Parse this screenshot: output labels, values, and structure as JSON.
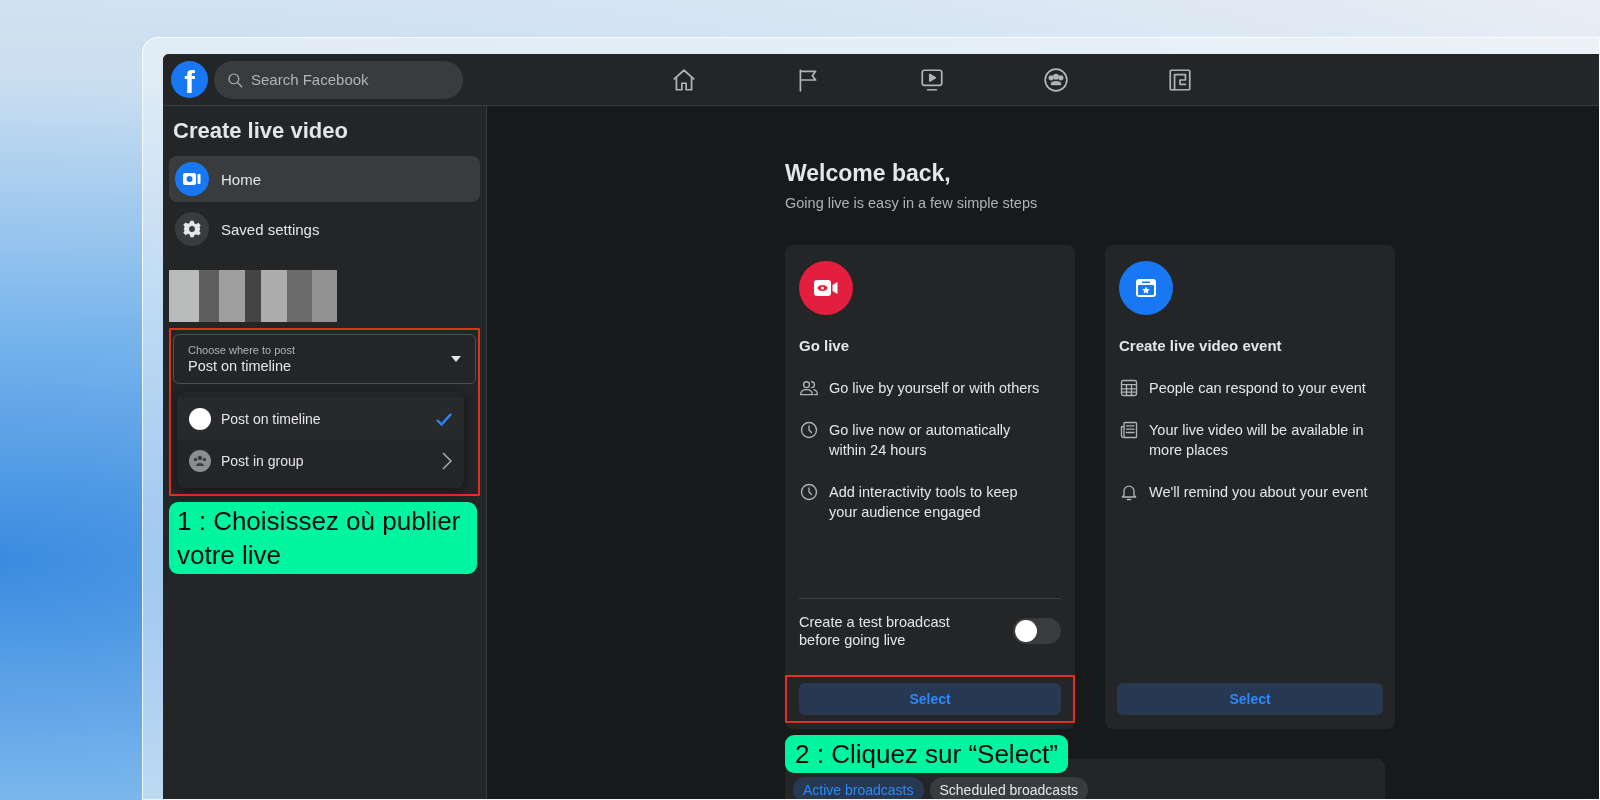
{
  "topbar": {
    "logo": "f",
    "search": {
      "placeholder": "Search Facebook"
    }
  },
  "sidebar": {
    "title": "Create live video",
    "items": [
      {
        "label": "Home",
        "selected": true
      },
      {
        "label": "Saved settings",
        "selected": false
      }
    ],
    "post_target": {
      "highlighted": true,
      "label": "Choose where to post",
      "value": "Post on timeline",
      "options": [
        {
          "label": "Post on timeline",
          "selected": true
        },
        {
          "label": "Post in group",
          "selected": false
        }
      ]
    }
  },
  "main": {
    "title": "Welcome back,",
    "subtitle": "Going live is easy in a few simple steps",
    "cards": [
      {
        "title": "Go live",
        "features": [
          "Go live by yourself or with others",
          "Go live now or automatically within 24 hours",
          "Add interactivity tools to keep your audience engaged"
        ],
        "toggle": {
          "label": "Create a test broadcast before going live",
          "on": false
        },
        "button": {
          "label": "Select",
          "highlighted": true
        }
      },
      {
        "title": "Create live video event",
        "features": [
          "People can respond to your event",
          "Your live video will be available in more places",
          "We'll remind you about your event"
        ],
        "button": {
          "label": "Select",
          "highlighted": false
        }
      }
    ],
    "broadcast_tabs": [
      {
        "label": "Active broadcasts",
        "selected": true
      },
      {
        "label": "Scheduled broadcasts",
        "selected": false
      }
    ]
  },
  "callouts": [
    "1 : Choisissez où publier votre live",
    "2 : Cliquez sur “Select”"
  ]
}
